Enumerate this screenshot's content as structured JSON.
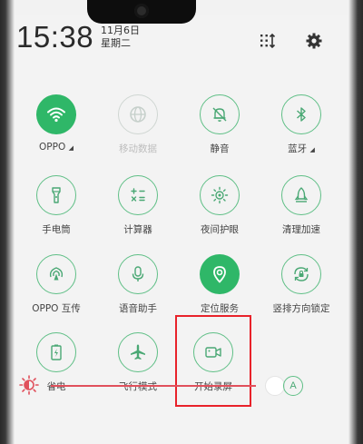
{
  "header": {
    "time": "15:38",
    "date_line1": "11月6日",
    "date_line2": "星期二",
    "edit_icon": "grid-edit-icon",
    "settings_icon": "gear-icon"
  },
  "tiles": [
    {
      "id": "wifi",
      "label": "OPPO",
      "icon": "wifi-icon",
      "state": "on",
      "has_menu": true
    },
    {
      "id": "mobile-data",
      "label": "移动数据",
      "icon": "globe-icon",
      "state": "disabled"
    },
    {
      "id": "mute",
      "label": "静音",
      "icon": "bell-off-icon",
      "state": "off"
    },
    {
      "id": "bluetooth",
      "label": "蓝牙",
      "icon": "bluetooth-icon",
      "state": "off",
      "has_menu": true
    },
    {
      "id": "flashlight",
      "label": "手电筒",
      "icon": "flashlight-icon",
      "state": "off"
    },
    {
      "id": "calculator",
      "label": "计算器",
      "icon": "calculator-icon",
      "state": "off"
    },
    {
      "id": "night-mode",
      "label": "夜间护眼",
      "icon": "eye-comfort-icon",
      "state": "off"
    },
    {
      "id": "clean",
      "label": "清理加速",
      "icon": "rocket-icon",
      "state": "off"
    },
    {
      "id": "oppo-share",
      "label": "OPPO 互传",
      "icon": "share-signal-icon",
      "state": "off"
    },
    {
      "id": "voice-assistant",
      "label": "语音助手",
      "icon": "microphone-icon",
      "state": "off"
    },
    {
      "id": "location",
      "label": "定位服务",
      "icon": "location-pin-icon",
      "state": "on"
    },
    {
      "id": "rotation-lock",
      "label": "竖排方向锁定",
      "icon": "rotation-lock-icon",
      "state": "off"
    },
    {
      "id": "power-saver",
      "label": "省电",
      "icon": "battery-icon",
      "state": "off"
    },
    {
      "id": "airplane",
      "label": "飞行模式",
      "icon": "airplane-icon",
      "state": "off"
    },
    {
      "id": "screen-record",
      "label": "开始录屏",
      "icon": "video-camera-icon",
      "state": "off",
      "highlighted": true
    }
  ],
  "brightness": {
    "icon": "brightness-icon",
    "level": 0.82,
    "auto_label": "A"
  },
  "colors": {
    "accent": "#2fb768",
    "outline": "#5fbf86",
    "highlight_box": "#e8222a",
    "brightness_track": "#e0505c"
  }
}
